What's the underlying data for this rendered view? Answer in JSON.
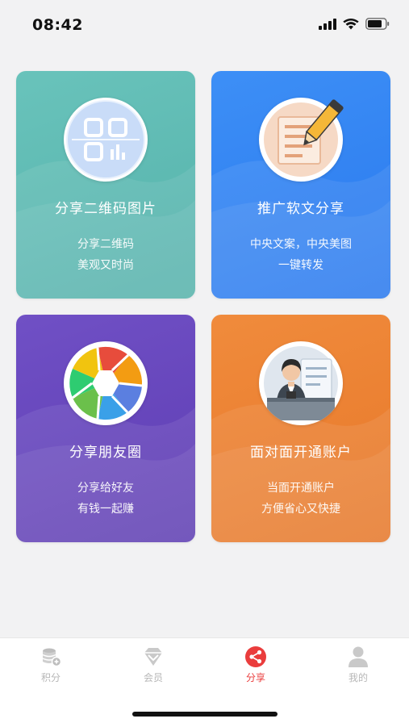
{
  "status_bar": {
    "time": "08:42"
  },
  "cards": [
    {
      "id": "qr",
      "title": "分享二维码图片",
      "desc_line1": "分享二维码",
      "desc_line2": "美观又时尚",
      "color": "#5fbbb4"
    },
    {
      "id": "article",
      "title": "推广软文分享",
      "desc_line1": "中央文案，中央美图",
      "desc_line2": "一键转发",
      "color": "#3385f3"
    },
    {
      "id": "moments",
      "title": "分享朋友圈",
      "desc_line1": "分享给好友",
      "desc_line2": "有钱一起赚",
      "color": "#6646bb"
    },
    {
      "id": "account",
      "title": "面对面开通账户",
      "desc_line1": "当面开通账户",
      "desc_line2": "方便省心又快捷",
      "color": "#ec8233"
    }
  ],
  "tabbar": {
    "items": [
      {
        "label": "积分",
        "icon": "coins-icon"
      },
      {
        "label": "会员",
        "icon": "diamond-icon"
      },
      {
        "label": "分享",
        "icon": "share-icon",
        "active": true
      },
      {
        "label": "我的",
        "icon": "user-icon"
      }
    ],
    "active_color": "#ea3d3d",
    "inactive_color": "#b7b7b7"
  }
}
